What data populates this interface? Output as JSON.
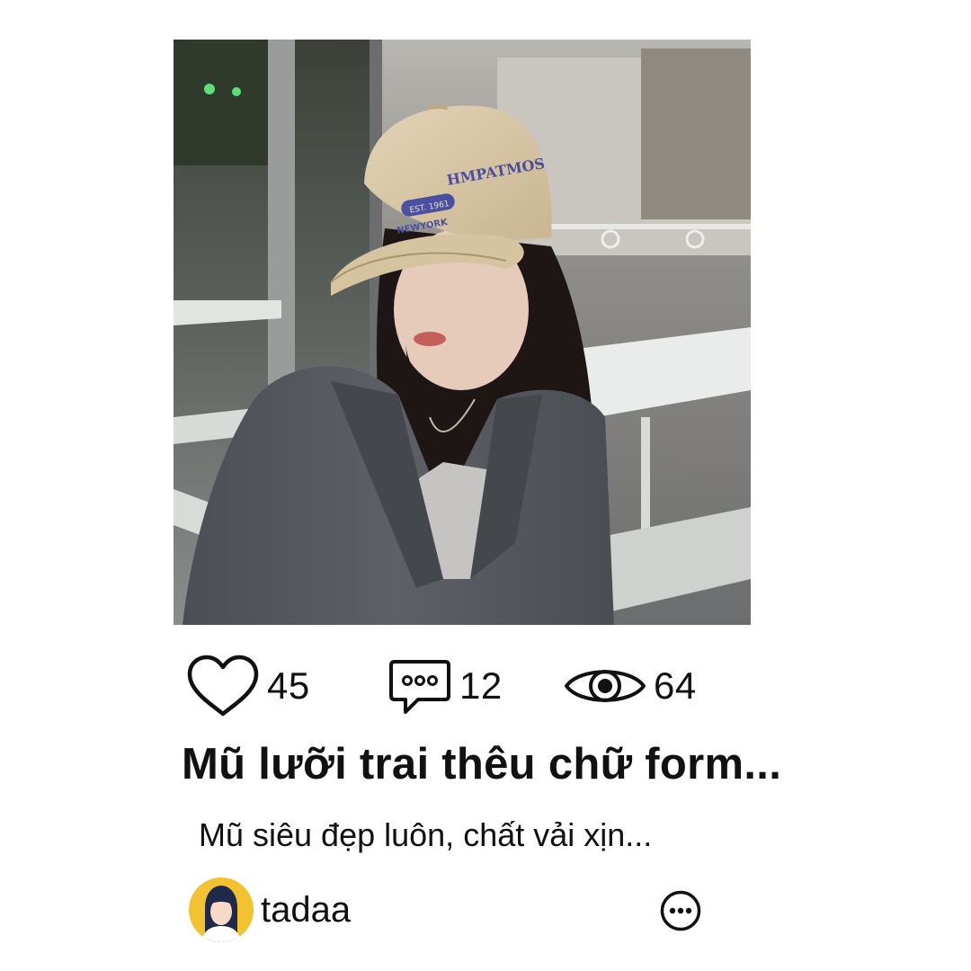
{
  "post": {
    "stats": {
      "likes": "45",
      "comments": "12",
      "views": "64"
    },
    "title": "Mũ lưỡi trai thêu chữ form...",
    "description": "Mũ siêu đẹp luôn, chất vải xịn...",
    "author": {
      "username": "tadaa"
    },
    "image_text": {
      "cap_brand": "HMPATMOS",
      "cap_est": "EST. 1961",
      "cap_city": "NEWYORK"
    }
  },
  "colors": {
    "avatar_bg": "#F2C230",
    "cap_color": "#D9C6A5",
    "cap_embroidery": "#4A4FA0",
    "blazer": "#55585E"
  },
  "icons": [
    "heart-icon",
    "comment-icon",
    "eye-icon",
    "more-icon",
    "avatar"
  ]
}
